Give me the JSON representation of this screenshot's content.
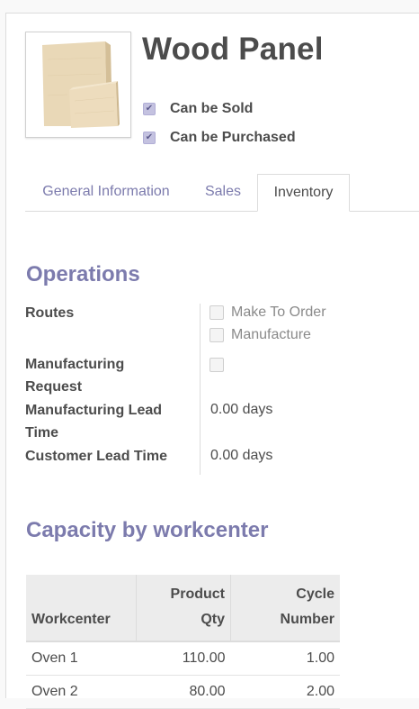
{
  "product": {
    "name": "Wood Panel",
    "image_alt": "wood panel product image",
    "can_be_sold_label": "Can be Sold",
    "can_be_sold": true,
    "can_be_purchased_label": "Can be Purchased",
    "can_be_purchased": true
  },
  "tabs": [
    {
      "label": "General Information",
      "active": false
    },
    {
      "label": "Sales",
      "active": false
    },
    {
      "label": "Inventory",
      "active": true
    }
  ],
  "operations": {
    "title": "Operations",
    "routes_label": "Routes",
    "routes": [
      {
        "label": "Make To Order",
        "checked": false
      },
      {
        "label": "Manufacture",
        "checked": false
      }
    ],
    "manufacturing_request_label_1": "Manufacturing",
    "manufacturing_request_label_2": "Request",
    "manufacturing_request_checked": false,
    "manufacturing_lead_time_label_1": "Manufacturing Lead",
    "manufacturing_lead_time_label_2": "Time",
    "manufacturing_lead_time_value": "0.00 days",
    "customer_lead_time_label": "Customer Lead Time",
    "customer_lead_time_value": "0.00 days"
  },
  "capacity": {
    "title": "Capacity by workcenter",
    "headers": {
      "workcenter": "Workcenter",
      "product_qty_1": "Product",
      "product_qty_2": "Qty",
      "cycle_number_1": "Cycle",
      "cycle_number_2": "Number"
    },
    "rows": [
      {
        "workcenter": "Oven 1",
        "product_qty": "110.00",
        "cycle_number": "1.00"
      },
      {
        "workcenter": "Oven 2",
        "product_qty": "80.00",
        "cycle_number": "2.00"
      }
    ]
  },
  "colors": {
    "accent": "#7c7bad",
    "text": "#4c4c4c",
    "checkbox_fill": "#c4c2e0"
  }
}
